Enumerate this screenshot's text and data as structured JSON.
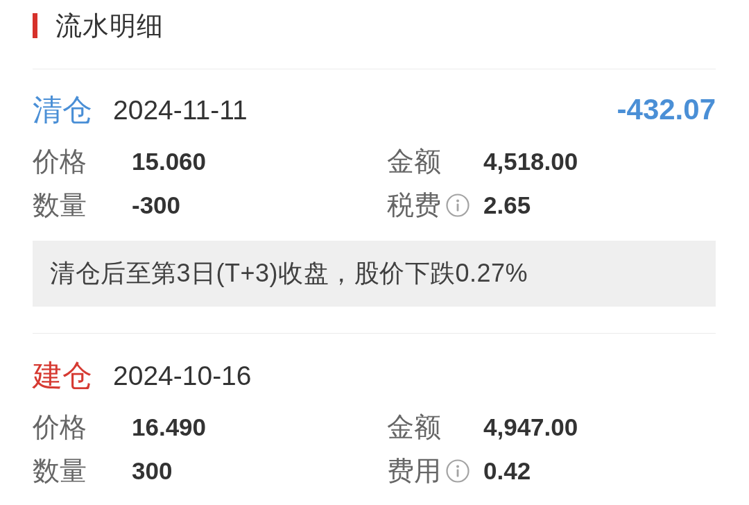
{
  "section": {
    "title": "流水明细"
  },
  "trades": [
    {
      "type": "清仓",
      "color": "#4a8fd6",
      "date": "2024-11-11",
      "profit": "-432.07",
      "fields": [
        {
          "label": "价格",
          "value": "15.060",
          "info": false
        },
        {
          "label": "金额",
          "value": "4,518.00",
          "info": false
        },
        {
          "label": "数量",
          "value": "-300",
          "info": false
        },
        {
          "label": "税费",
          "value": "2.65",
          "info": true
        }
      ],
      "note": "清仓后至第3日(T+3)收盘，股价下跌0.27%"
    },
    {
      "type": "建仓",
      "color": "#d63a32",
      "date": "2024-10-16",
      "fields": [
        {
          "label": "价格",
          "value": "16.490",
          "info": false
        },
        {
          "label": "金额",
          "value": "4,947.00",
          "info": false
        },
        {
          "label": "数量",
          "value": "300",
          "info": false
        },
        {
          "label": "费用",
          "value": "0.42",
          "info": true
        }
      ]
    }
  ]
}
